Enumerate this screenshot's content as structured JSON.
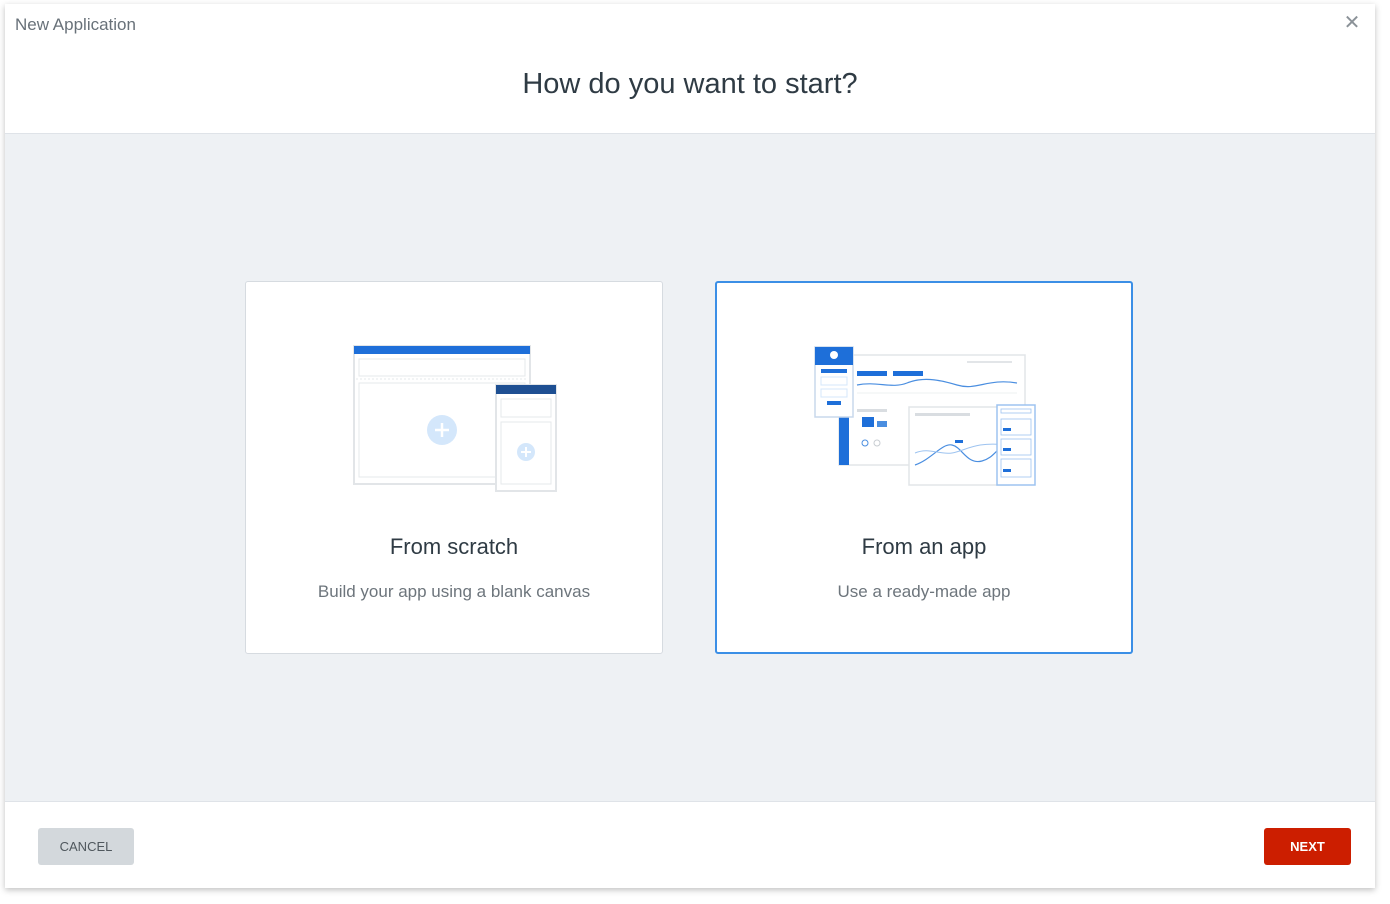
{
  "dialog": {
    "title": "New Application",
    "close_icon": "close-icon",
    "heading": "How do you want to start?"
  },
  "options": [
    {
      "title": "From scratch",
      "subtitle": "Build your app using a blank canvas",
      "illustration": "blank-canvas-illustration",
      "selected": false
    },
    {
      "title": "From an app",
      "subtitle": "Use a ready-made app",
      "illustration": "ready-made-app-illustration",
      "selected": true
    }
  ],
  "footer": {
    "cancel_label": "CANCEL",
    "next_label": "NEXT"
  },
  "colors": {
    "accent": "#3b8fe6",
    "primary_button": "#cc1e00",
    "secondary_button": "#d3d8dc",
    "body_background": "#eef1f4",
    "illustration_blue": "#1e6fd9"
  }
}
